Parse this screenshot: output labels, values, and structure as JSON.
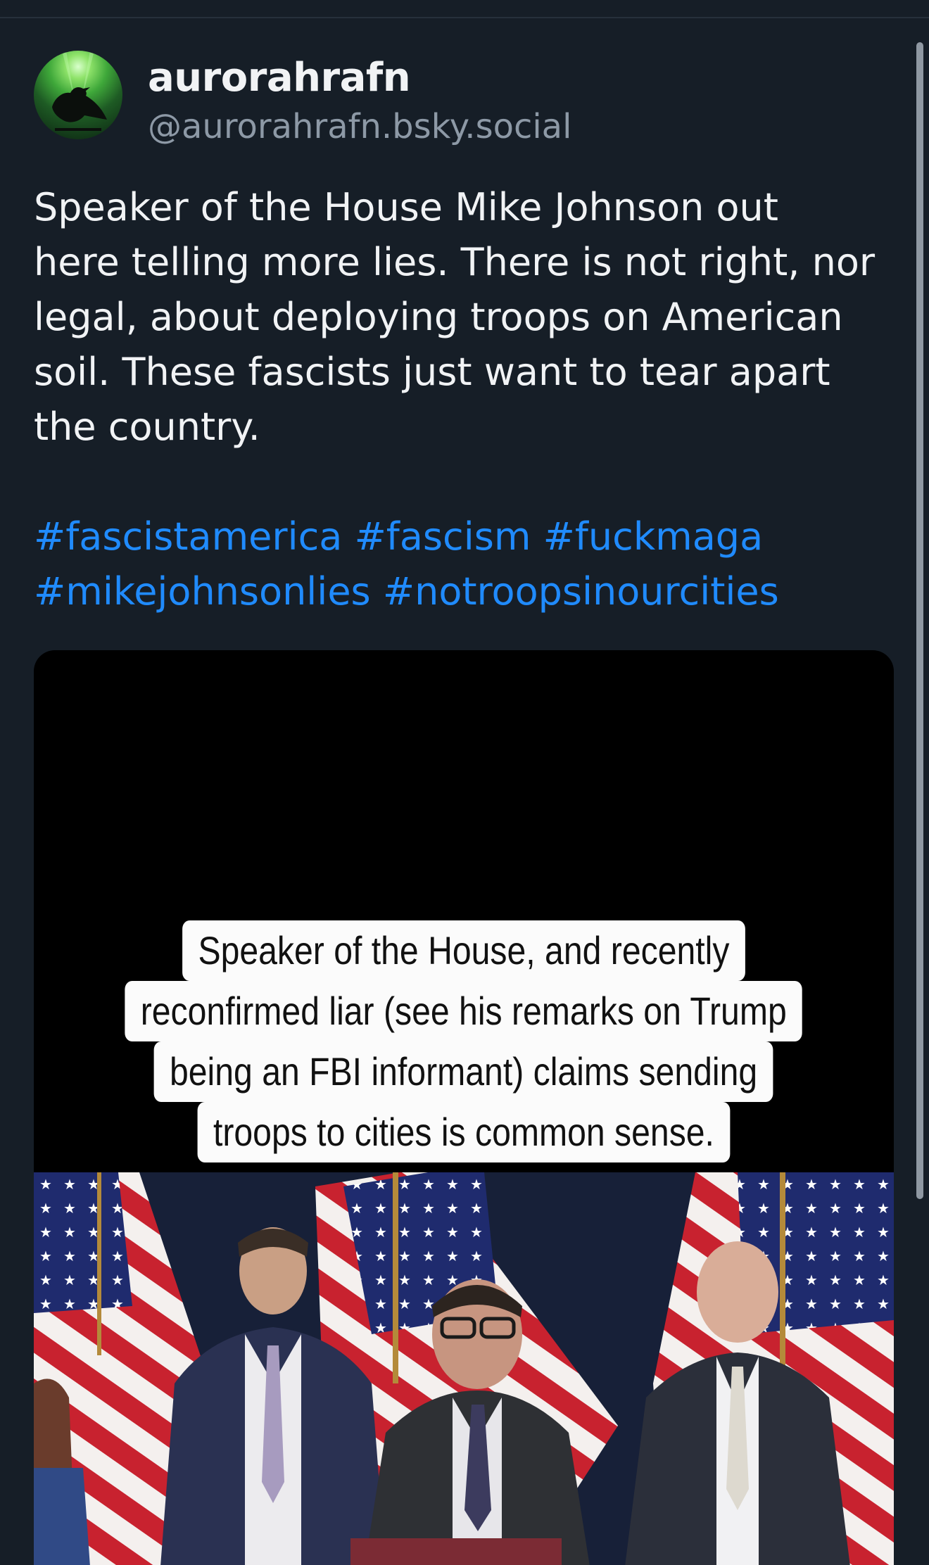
{
  "post": {
    "author": {
      "display_name": "aurorahrafn",
      "handle": "@aurorahrafn.bsky.social"
    },
    "text_lines": [
      "Speaker of the House Mike Johnson out",
      "here telling more lies. There is not right, nor",
      "legal, about deploying troops on American",
      "soil. These fascists just want to tear apart",
      "the country."
    ],
    "hashtags_line1": [
      "#fascistamerica",
      "#fascism",
      "#fuckmaga"
    ],
    "hashtags_line2": [
      "#mikejohnsonlies",
      "#notroopsinourcities"
    ],
    "media": {
      "caption_lines": [
        "Speaker of the House, and recently",
        "reconfirmed liar (see his remarks on Trump",
        "being an FBI informant) claims sending",
        "troops to cities is common sense."
      ]
    }
  },
  "colors": {
    "background": "#161e27",
    "text": "#f1f3f5",
    "handle": "#8d99a6",
    "link": "#208bfe"
  }
}
